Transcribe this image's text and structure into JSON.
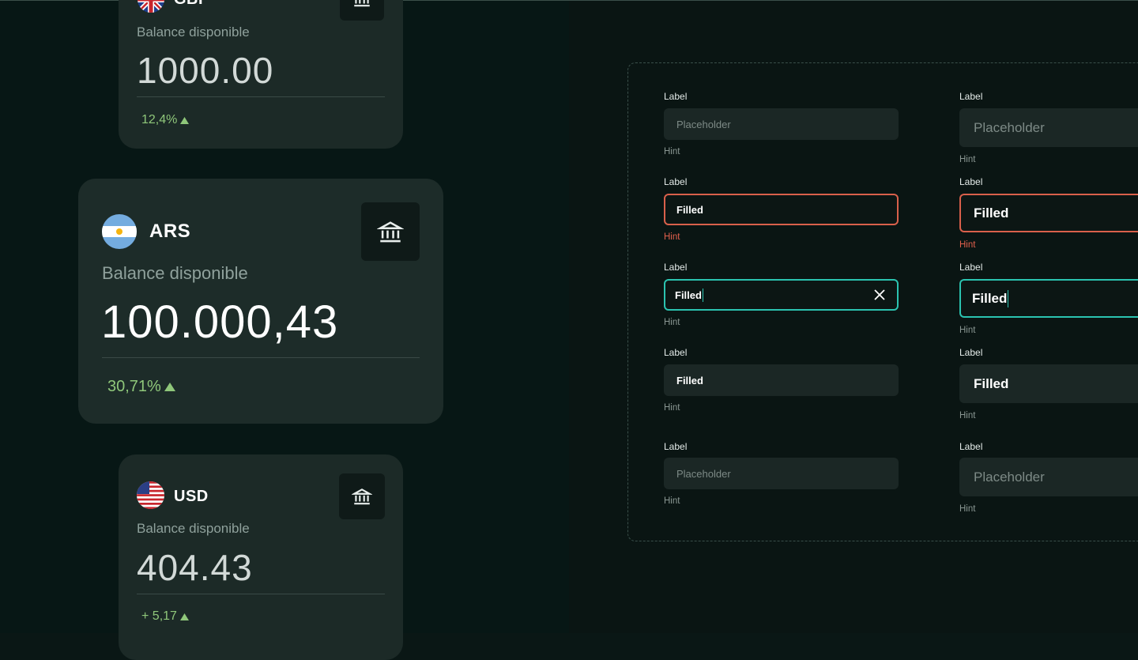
{
  "cards": {
    "gbp": {
      "code": "GBP",
      "balance_label": "Balance disponible",
      "amount": "1000.00",
      "change": "12,4%"
    },
    "ars": {
      "code": "ARS",
      "balance_label": "Balance disponible",
      "amount": "100.000,43",
      "change": "30,71%"
    },
    "usd": {
      "code": "USD",
      "balance_label": "Balance disponible",
      "amount": "404.43",
      "change": "+ 5,17"
    }
  },
  "form_small": [
    {
      "label": "Label",
      "placeholder": "Placeholder",
      "value": "",
      "hint": "Hint",
      "state": "default"
    },
    {
      "label": "Label",
      "placeholder": "",
      "value": "Filled",
      "hint": "Hint",
      "state": "error"
    },
    {
      "label": "Label",
      "placeholder": "",
      "value": "Filled",
      "hint": "Hint",
      "state": "focus"
    },
    {
      "label": "Label",
      "placeholder": "",
      "value": "Filled",
      "hint": "Hint",
      "state": "filled"
    },
    {
      "label": "Label",
      "placeholder": "Placeholder",
      "value": "",
      "hint": "Hint",
      "state": "disabled"
    }
  ],
  "form_large": [
    {
      "label": "Label",
      "placeholder": "Placeholder",
      "value": "",
      "hint": "Hint",
      "state": "default"
    },
    {
      "label": "Label",
      "placeholder": "",
      "value": "Filled",
      "hint": "Hint",
      "state": "error"
    },
    {
      "label": "Label",
      "placeholder": "",
      "value": "Filled",
      "hint": "Hint",
      "state": "focus"
    },
    {
      "label": "Label",
      "placeholder": "",
      "value": "Filled",
      "hint": "Hint",
      "state": "filled"
    },
    {
      "label": "Label",
      "placeholder": "Placeholder",
      "value": "",
      "hint": "Hint",
      "state": "disabled"
    }
  ],
  "colors": {
    "error": "#d9604b",
    "focus": "#2bc3b0",
    "positive": "#8fc77a",
    "card_bg": "#1d2c29"
  },
  "icons": {
    "bank": "bank-icon",
    "clear": "close-icon",
    "trend": "triangle-up-icon"
  }
}
